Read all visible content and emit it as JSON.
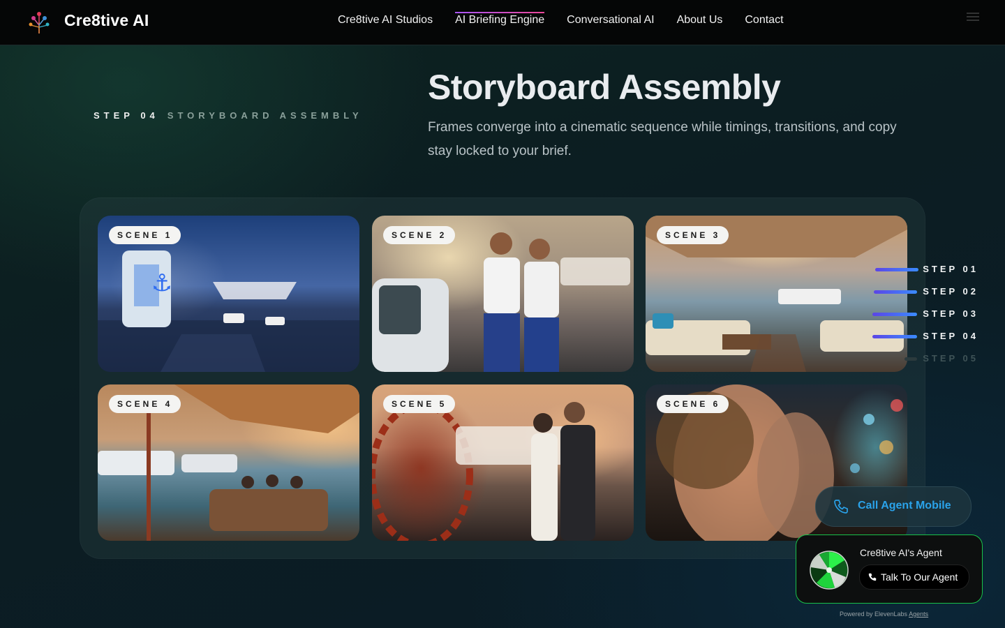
{
  "brand": {
    "name": "Cre8tive AI",
    "logo_icon": "tree-logo-icon"
  },
  "nav": {
    "links": [
      {
        "label": "Cre8tive AI Studios",
        "active": false
      },
      {
        "label": "AI Briefing Engine",
        "active": true
      },
      {
        "label": "Conversational AI",
        "active": false
      },
      {
        "label": "About Us",
        "active": false
      },
      {
        "label": "Contact",
        "active": false
      }
    ],
    "menu_icon": "hamburger-menu-icon"
  },
  "hero": {
    "step_label": "STEP 04",
    "step_sub": "STORYBOARD ASSEMBLY",
    "title": "Storyboard Assembly",
    "subtitle": "Frames converge into a cinematic sequence while timings, transitions, and copy stay locked to your brief."
  },
  "scenes": [
    {
      "label": "SCENE 1"
    },
    {
      "label": "SCENE 2"
    },
    {
      "label": "SCENE 3"
    },
    {
      "label": "SCENE 4"
    },
    {
      "label": "SCENE 5"
    },
    {
      "label": "SCENE 6"
    }
  ],
  "steps": [
    {
      "label": "STEP 01",
      "active": true
    },
    {
      "label": "STEP 02",
      "active": true
    },
    {
      "label": "STEP 03",
      "active": true
    },
    {
      "label": "STEP 04",
      "active": true
    },
    {
      "label": "STEP 05",
      "active": false
    }
  ],
  "call": {
    "label": "Call Agent Mobile",
    "icon": "phone-icon"
  },
  "agent": {
    "name": "Cre8tive AI's Agent",
    "talk_label": "Talk To Our Agent",
    "powered_prefix": "Powered by ElevenLabs",
    "powered_link": "Agents"
  },
  "colors": {
    "accent_gradient_start": "#a855f7",
    "accent_gradient_end": "#ec4899",
    "step_bar": "#5b45e6",
    "call_text": "#2aa3ea",
    "agent_border": "#19c24a"
  }
}
